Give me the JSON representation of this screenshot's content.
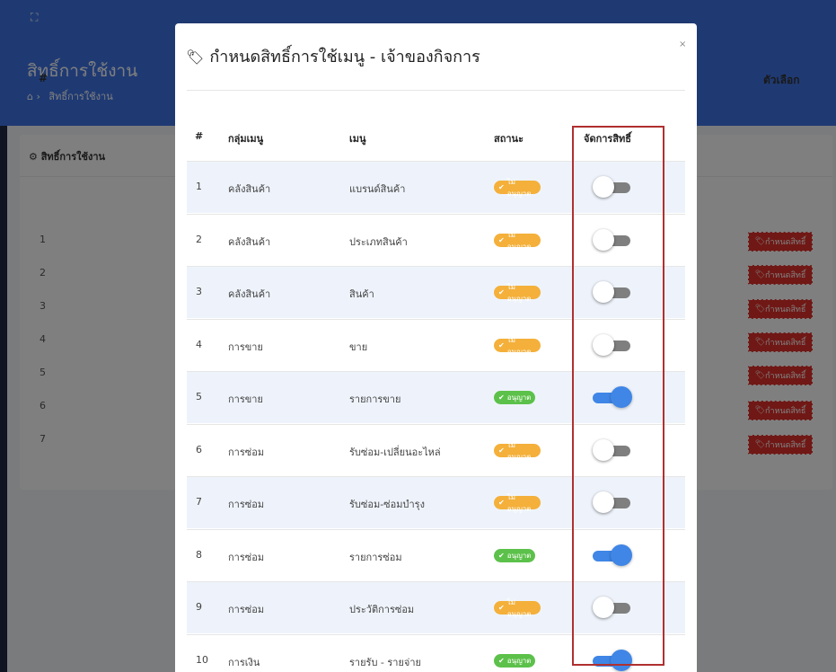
{
  "background": {
    "page_title": "สิทธิ์การใช้งาน",
    "breadcrumb": "สิทธิ์การใช้งาน",
    "card_title": "สิทธิ์การใช้งาน",
    "col_hash": "#",
    "col_options": "ตัวเลือก",
    "row_numbers": [
      "1",
      "2",
      "3",
      "4",
      "5",
      "6",
      "7"
    ],
    "action_label": "กำหนดสิทธิ์"
  },
  "modal": {
    "title": "กำหนดสิทธิ์การใช้เมนู - เจ้าของกิจการ",
    "close": "×",
    "columns": {
      "num": "#",
      "group": "กลุ่มเมนู",
      "menu": "เมนู",
      "status": "สถานะ",
      "manage": "จัดการสิทธิ์"
    },
    "rows": [
      {
        "num": "1",
        "group": "คลังสินค้า",
        "menu": "แบรนด์สินค้า",
        "status": "ไม่อนุญาต",
        "allowed": false
      },
      {
        "num": "2",
        "group": "คลังสินค้า",
        "menu": "ประเภทสินค้า",
        "status": "ไม่อนุญาต",
        "allowed": false
      },
      {
        "num": "3",
        "group": "คลังสินค้า",
        "menu": "สินค้า",
        "status": "ไม่อนุญาต",
        "allowed": false
      },
      {
        "num": "4",
        "group": "การขาย",
        "menu": "ขาย",
        "status": "ไม่อนุญาต",
        "allowed": false
      },
      {
        "num": "5",
        "group": "การขาย",
        "menu": "รายการขาย",
        "status": "อนุญาต",
        "allowed": true
      },
      {
        "num": "6",
        "group": "การซ่อม",
        "menu": "รับซ่อม-เปลี่ยนอะไหล่",
        "status": "ไม่อนุญาต",
        "allowed": false
      },
      {
        "num": "7",
        "group": "การซ่อม",
        "menu": "รับซ่อม-ซ่อมบำรุง",
        "status": "ไม่อนุญาต",
        "allowed": false
      },
      {
        "num": "8",
        "group": "การซ่อม",
        "menu": "รายการซ่อม",
        "status": "อนุญาต",
        "allowed": true
      },
      {
        "num": "9",
        "group": "การซ่อม",
        "menu": "ประวัติการซ่อม",
        "status": "ไม่อนุญาต",
        "allowed": false
      },
      {
        "num": "10",
        "group": "การเงิน",
        "menu": "รายรับ - รายจ่าย",
        "status": "อนุญาต",
        "allowed": true
      }
    ]
  },
  "colors": {
    "primary": "#3f74e6",
    "toggle_on": "#3f86e6",
    "deny_badge": "#f4b03a",
    "allow_badge": "#5cc14a",
    "danger": "#e0312b",
    "highlight": "#b03030"
  },
  "icons": {
    "tag": "tag-icon",
    "close": "close-icon",
    "home": "home-icon",
    "gear": "gear-icon",
    "check": "check-circle-icon"
  }
}
